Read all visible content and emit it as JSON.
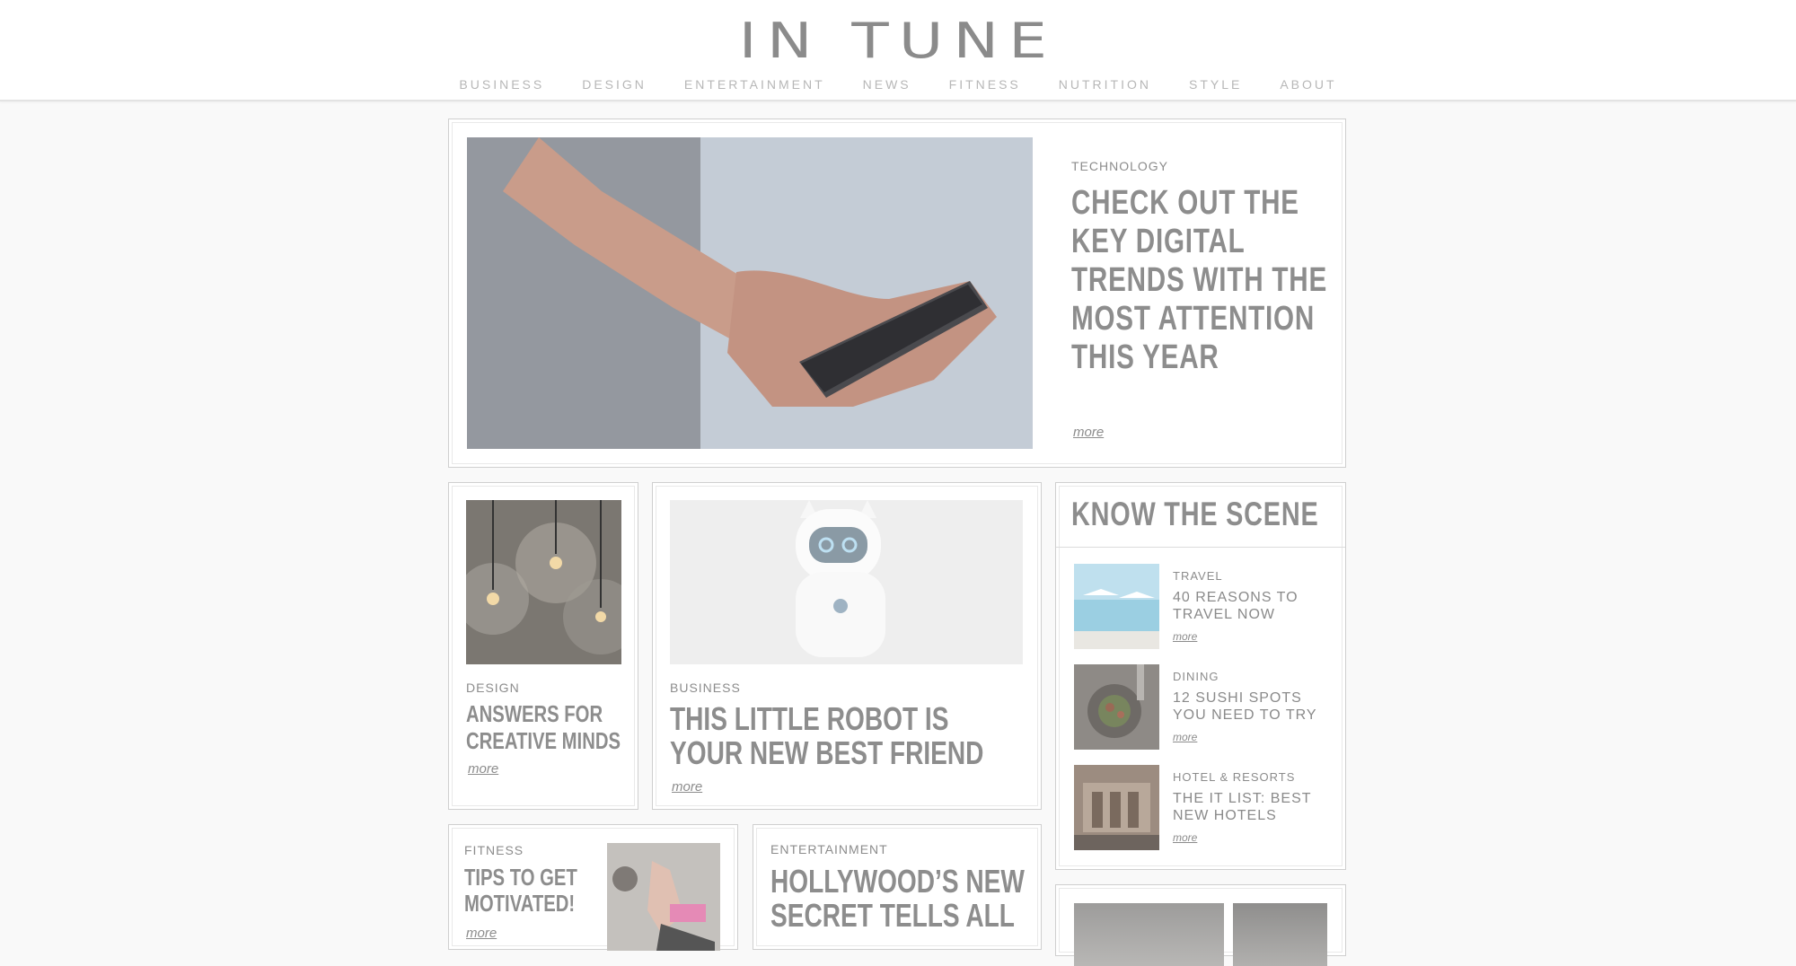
{
  "site": {
    "logo": "IN TUNE"
  },
  "nav": [
    "BUSINESS",
    "DESIGN",
    "ENTERTAINMENT",
    "NEWS",
    "FITNESS",
    "NUTRITION",
    "STYLE",
    "ABOUT"
  ],
  "hero": {
    "category": "TECHNOLOGY",
    "title": "CHECK OUT THE KEY DIGITAL TRENDS WITH THE MOST ATTENTION THIS YEAR",
    "more": "more"
  },
  "design_card": {
    "category": "DESIGN",
    "title": "ANSWERS FOR CREATIVE MINDS",
    "more": "more"
  },
  "robot_card": {
    "category": "BUSINESS",
    "title": "THIS LITTLE ROBOT IS YOUR NEW BEST FRIEND",
    "more": "more"
  },
  "scene": {
    "title": "KNOW THE SCENE",
    "items": [
      {
        "category": "TRAVEL",
        "title": "40 REASONS TO TRAVEL NOW",
        "more": "more"
      },
      {
        "category": "DINING",
        "title": "12 SUSHI SPOTS YOU NEED TO TRY",
        "more": "more"
      },
      {
        "category": "HOTEL & RESORTS",
        "title": "THE IT LIST: BEST NEW HOTELS",
        "more": "more"
      }
    ]
  },
  "fitness_card": {
    "category": "FITNESS",
    "title": "TIPS TO GET MOTIVATED!",
    "more": "more"
  },
  "ent_card": {
    "category": "ENTERTAINMENT",
    "title": "HOLLYWOOD’S NEW SECRET TELLS ALL"
  }
}
